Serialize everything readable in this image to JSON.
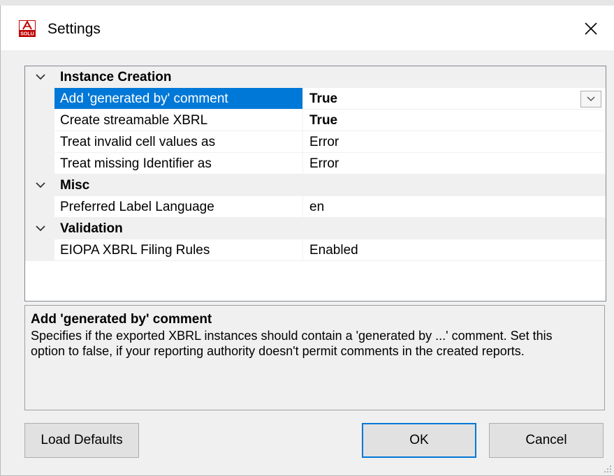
{
  "window": {
    "title": "Settings",
    "app_icon_text": "SOLU"
  },
  "grid": {
    "categories": [
      {
        "label": "Instance Creation",
        "rows": [
          {
            "name": "Add 'generated by' comment",
            "value": "True"
          },
          {
            "name": "Create streamable XBRL",
            "value": "True"
          },
          {
            "name": "Treat invalid cell values as",
            "value": "Error"
          },
          {
            "name": "Treat missing Identifier as",
            "value": "Error"
          }
        ]
      },
      {
        "label": "Misc",
        "rows": [
          {
            "name": "Preferred Label Language",
            "value": "en"
          }
        ]
      },
      {
        "label": "Validation",
        "rows": [
          {
            "name": "EIOPA XBRL Filing Rules",
            "value": "Enabled"
          }
        ]
      }
    ]
  },
  "description": {
    "title": "Add 'generated by' comment",
    "text": "Specifies if the exported XBRL instances should contain a 'generated by ...' comment. Set this option to false, if your reporting authority doesn't permit comments in the created reports."
  },
  "buttons": {
    "load_defaults": "Load Defaults",
    "ok": "OK",
    "cancel": "Cancel"
  },
  "colors": {
    "selection": "#0078d7",
    "category_bg": "#f0f0f0",
    "window_bg": "#f0f0f0"
  }
}
